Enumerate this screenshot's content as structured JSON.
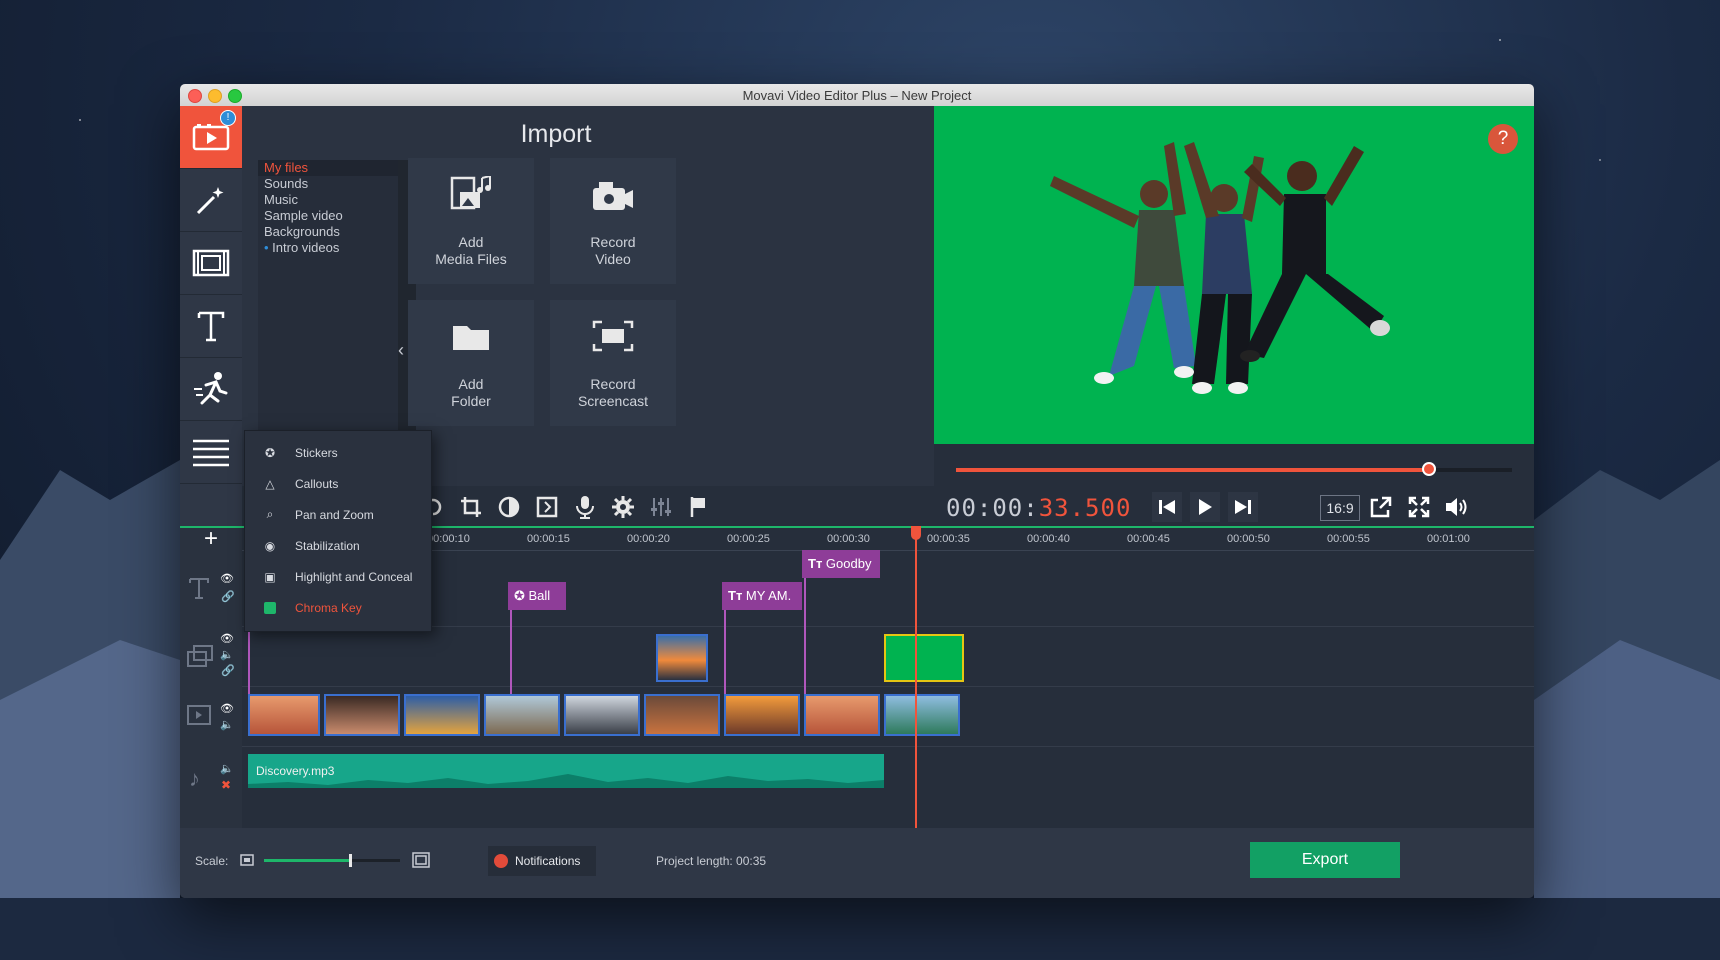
{
  "window": {
    "title": "Movavi Video Editor Plus – New Project"
  },
  "rail": {
    "badge": "!",
    "items": [
      "import-icon",
      "magic-wand-icon",
      "transitions-icon",
      "titles-icon",
      "motion-icon",
      "more-tools-icon"
    ]
  },
  "import": {
    "title": "Import",
    "files": [
      "My files",
      "Sounds",
      "Music",
      "Sample video",
      "Backgrounds",
      "Intro videos"
    ],
    "tiles": {
      "add_media": [
        "Add",
        "Media Files"
      ],
      "record_video": [
        "Record",
        "Video"
      ],
      "add_folder": [
        "Add",
        "Folder"
      ],
      "record_screencast": [
        "Record",
        "Screencast"
      ]
    }
  },
  "menu": {
    "items": [
      "Stickers",
      "Callouts",
      "Pan and Zoom",
      "Stabilization",
      "Highlight and Conceal",
      "Chroma Key"
    ]
  },
  "player": {
    "timecode_prefix": "00:00:",
    "timecode_suffix": "33.500",
    "aspect": "16:9",
    "progress": 0.85,
    "help": "?"
  },
  "timeline": {
    "ticks": [
      "00:00:10",
      "00:00:15",
      "00:00:20",
      "00:00:25",
      "00:00:30",
      "00:00:35",
      "00:00:40",
      "00:00:45",
      "00:00:50",
      "00:00:55",
      "00:01:00"
    ],
    "titles": [
      "Ball",
      "MY AM.",
      "Goodby"
    ],
    "audio": "Discovery.mp3"
  },
  "bottom": {
    "scale_label": "Scale:",
    "scale_level": 0.63,
    "notifications": "Notifications",
    "project_length": "Project length:  00:35",
    "export": "Export"
  },
  "colors": {
    "accent": "#f0543c",
    "green": "#1eb66a",
    "export": "#12a064"
  }
}
